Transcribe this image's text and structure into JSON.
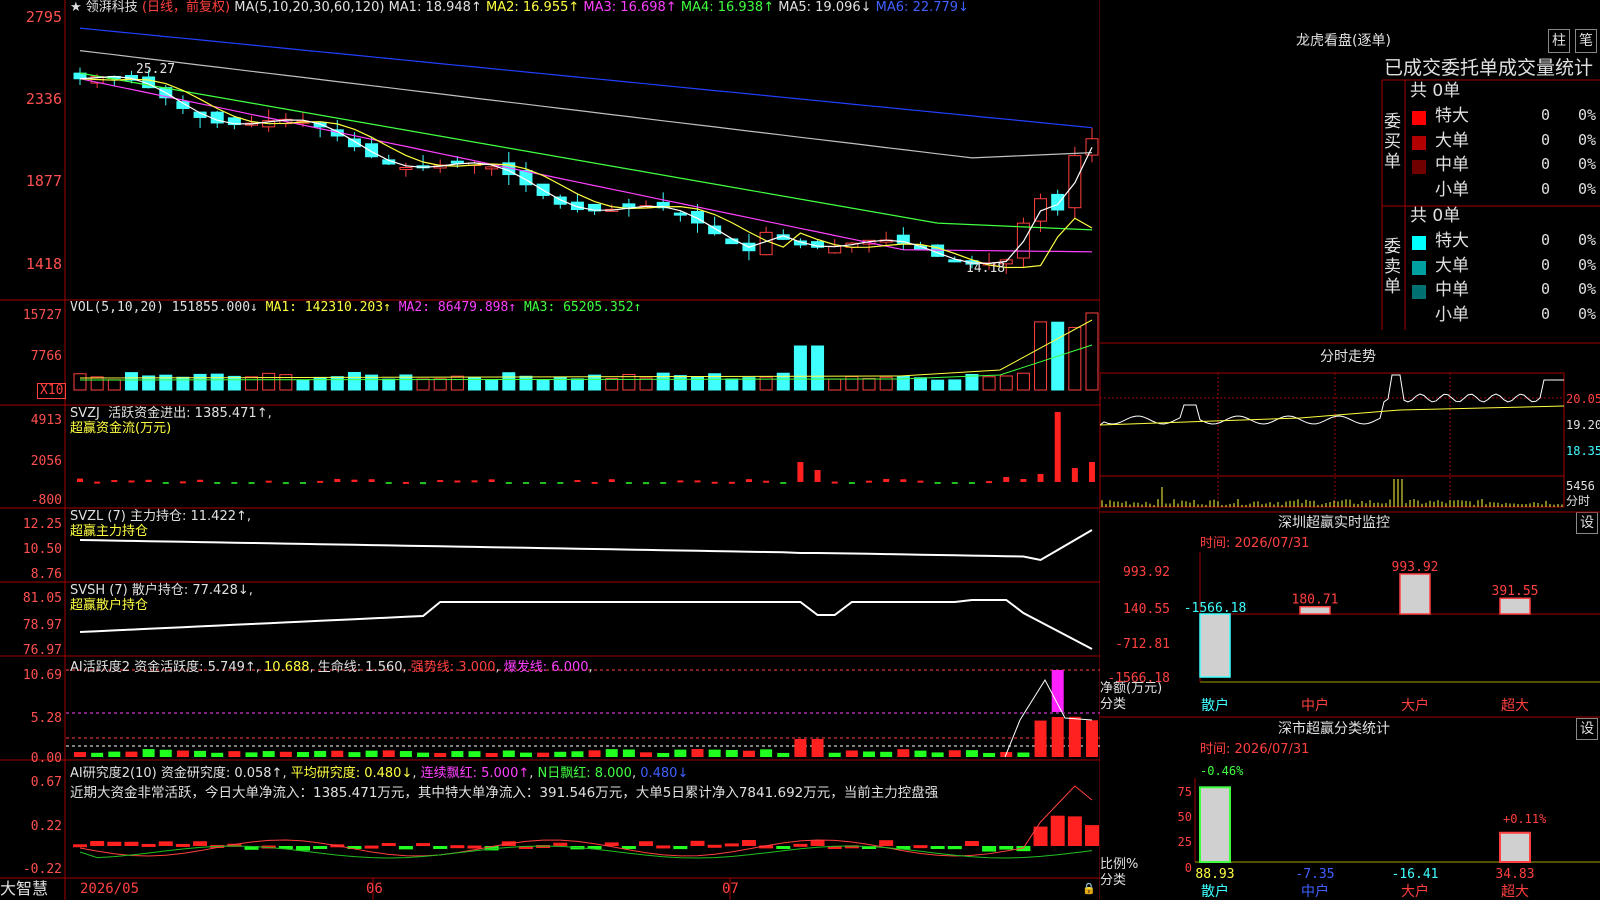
{
  "stock": {
    "name": "领湃科技",
    "mode": "(日线，前复权)",
    "ma_label": "MA(5,10,20,30,60,120)",
    "ma1": "MA1: 18.948↑",
    "ma2": "MA2: 16.955↑",
    "ma3": "MA3: 16.698↑",
    "ma4": "MA4: 16.938↑",
    "ma5": "MA5: 19.096↓",
    "ma6": "MA6: 22.779↓",
    "price_axis": [
      "2795",
      "2336",
      "1877",
      "1418"
    ],
    "high_label": "25.27",
    "low_label": "14.18"
  },
  "vol": {
    "label": "VOL(5,10,20)",
    "value": "151855.000↓",
    "ma1": "MA1: 142310.203↑",
    "ma2": "MA2: 86479.898↑",
    "ma3": "MA3: 65205.352↑",
    "axis": [
      "15727",
      "7766"
    ],
    "unit": "X10"
  },
  "svzj": {
    "label": "SVZJ",
    "title": "活跃资金进出: 1385.471↑,",
    "sub": "超赢资金流(万元)",
    "axis": [
      "4913",
      "2056",
      "-800"
    ]
  },
  "svzl": {
    "label": "SVZL (7)",
    "title": "主力持仓: 11.422↑,",
    "sub": "超赢主力持仓",
    "axis": [
      "12.25",
      "10.50",
      "8.76"
    ]
  },
  "svsh": {
    "label": "SVSH (7)",
    "title": "散户持仓: 77.428↓,",
    "sub": "超赢散户持仓",
    "axis": [
      "81.05",
      "78.97",
      "76.97"
    ]
  },
  "ai1": {
    "label": "AI活跃度2",
    "a": "资金活跃度: 5.749↑",
    "b": "10.688",
    "c": "生命线: 1.560",
    "d": "强势线: 3.000",
    "e": "爆发线: 6.000",
    "axis": [
      "10.69",
      "5.28",
      "0.00"
    ]
  },
  "ai2": {
    "label": "AI研究度2(10)",
    "a": "资金研究度: 0.058↑",
    "b": "平均研究度: 0.480↓",
    "c": "连续飘红: 5.000↑",
    "d": "N日飘红: 8.000",
    "e": "0.480↓",
    "comment": "近期大资金非常活跃，今日大单净流入：1385.471万元，其中特大单净流入：391.546万元，大单5日累计净入7841.692万元，当前主力控盘强",
    "axis": [
      "0.67",
      "0.22",
      "-0.22"
    ]
  },
  "footer": {
    "brand": "大智慧",
    "dates": [
      "2026/05",
      "06",
      "07"
    ]
  },
  "dragon": {
    "title": "龙虎看盘(逐单)",
    "btn1": "柱",
    "btn2": "笔",
    "stat_title": "已成交委托单成交量统计",
    "buy_label": "委买单",
    "sell_label": "委卖单",
    "buy_total": "共 0单",
    "sell_total": "共 0单",
    "buy_rows": [
      {
        "name": "特大",
        "n": "0",
        "p": "0%",
        "color": "#ff0000"
      },
      {
        "name": "大单",
        "n": "0",
        "p": "0%",
        "color": "#b00000"
      },
      {
        "name": "中单",
        "n": "0",
        "p": "0%",
        "color": "#700000"
      },
      {
        "name": "小单",
        "n": "0",
        "p": "0%",
        "color": ""
      }
    ],
    "sell_rows": [
      {
        "name": "特大",
        "n": "0",
        "p": "0%",
        "color": "#00ffff"
      },
      {
        "name": "大单",
        "n": "0",
        "p": "0%",
        "color": "#00a0a0"
      },
      {
        "name": "中单",
        "n": "0",
        "p": "0%",
        "color": "#007070"
      },
      {
        "name": "小单",
        "n": "0",
        "p": "0%",
        "color": ""
      }
    ]
  },
  "intraday": {
    "title": "分时走势",
    "axis": [
      "20.05",
      "19.20",
      "18.35"
    ],
    "vol": "5456",
    "vol_unit": "分时"
  },
  "sz_monitor": {
    "title": "深圳超赢实时监控",
    "settings": "设",
    "time": "时间: 2026/07/31",
    "axis": [
      "993.92",
      "140.55",
      "-712.81",
      "-1566.18"
    ],
    "ylabel": "净额(万元)",
    "xlabel": "分类",
    "cats": [
      "散户",
      "中户",
      "大户",
      "超大"
    ],
    "values": [
      -1566.18,
      180.71,
      993.92,
      391.55
    ],
    "value_labels": [
      "-1566.18",
      "180.71",
      "993.92",
      "391.55"
    ]
  },
  "sz_class": {
    "title": "深市超赢分类统计",
    "settings": "设",
    "time": "时间: 2026/07/31",
    "axis": [
      "75",
      "50",
      "25",
      "0"
    ],
    "ylabel": "比例%",
    "xlabel": "分类",
    "cats": [
      "散户",
      "中户",
      "大户",
      "超大"
    ],
    "values": [
      88.93,
      -7.35,
      -16.41,
      34.83
    ],
    "value_labels": [
      "88.93",
      "-7.35",
      "-16.41",
      "34.83"
    ],
    "top_labels": [
      "-0.46%",
      "+0.11%"
    ]
  }
}
